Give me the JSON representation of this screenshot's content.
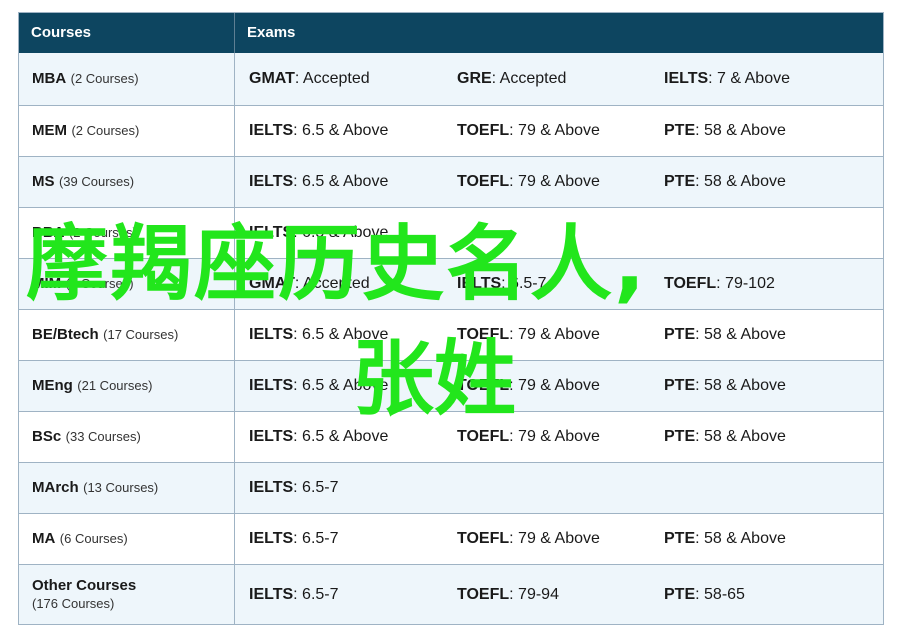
{
  "header": {
    "courses": "Courses",
    "exams": "Exams"
  },
  "rows": [
    {
      "name": "MBA",
      "count": "(2 Courses)",
      "exams": [
        {
          "name": "GMAT",
          "value": ": Accepted"
        },
        {
          "name": "GRE",
          "value": ": Accepted"
        },
        {
          "name": "IELTS",
          "value": ": 7 & Above"
        }
      ]
    },
    {
      "name": "MEM",
      "count": "(2 Courses)",
      "exams": [
        {
          "name": "IELTS",
          "value": ": 6.5 & Above"
        },
        {
          "name": "TOEFL",
          "value": ": 79 & Above"
        },
        {
          "name": "PTE",
          "value": ": 58 & Above"
        }
      ]
    },
    {
      "name": "MS",
      "count": "(39 Courses)",
      "exams": [
        {
          "name": "IELTS",
          "value": ": 6.5 & Above"
        },
        {
          "name": "TOEFL",
          "value": ": 79 & Above"
        },
        {
          "name": "PTE",
          "value": ": 58 & Above"
        }
      ]
    },
    {
      "name": "BBA",
      "count": "(2 Courses)",
      "exams": [
        {
          "name": "IELTS",
          "value": ": 6.5 & Above"
        }
      ]
    },
    {
      "name": "MIM",
      "count": "(3 Courses)",
      "exams": [
        {
          "name": "GMAT",
          "value": ": Accepted"
        },
        {
          "name": "IELTS",
          "value": ": 6.5-7"
        },
        {
          "name": "TOEFL",
          "value": ": 79-102"
        }
      ]
    },
    {
      "name": "BE/Btech",
      "count": "(17 Courses)",
      "exams": [
        {
          "name": "IELTS",
          "value": ": 6.5 & Above"
        },
        {
          "name": "TOEFL",
          "value": ": 79 & Above"
        },
        {
          "name": "PTE",
          "value": ": 58 & Above"
        }
      ]
    },
    {
      "name": "MEng",
      "count": "(21 Courses)",
      "exams": [
        {
          "name": "IELTS",
          "value": ": 6.5 & Above"
        },
        {
          "name": "TOEFL",
          "value": ": 79 & Above"
        },
        {
          "name": "PTE",
          "value": ": 58 & Above"
        }
      ]
    },
    {
      "name": "BSc",
      "count": "(33 Courses)",
      "exams": [
        {
          "name": "IELTS",
          "value": ": 6.5 & Above"
        },
        {
          "name": "TOEFL",
          "value": ": 79 & Above"
        },
        {
          "name": "PTE",
          "value": ": 58 & Above"
        }
      ]
    },
    {
      "name": "MArch",
      "count": "(13 Courses)",
      "exams": [
        {
          "name": "IELTS",
          "value": ": 6.5-7"
        }
      ]
    },
    {
      "name": "MA",
      "count": "(6 Courses)",
      "exams": [
        {
          "name": "IELTS",
          "value": ": 6.5-7"
        },
        {
          "name": "TOEFL",
          "value": ": 79 & Above"
        },
        {
          "name": "PTE",
          "value": ": 58 & Above"
        }
      ]
    },
    {
      "name": "Other Courses",
      "count": "(176 Courses)",
      "exams": [
        {
          "name": "IELTS",
          "value": ": 6.5-7"
        },
        {
          "name": "TOEFL",
          "value": ": 79-94"
        },
        {
          "name": "PTE",
          "value": ": 58-65"
        }
      ]
    }
  ],
  "overlay": {
    "line1": "摩羯座历史名人,",
    "line2": "张姓"
  }
}
